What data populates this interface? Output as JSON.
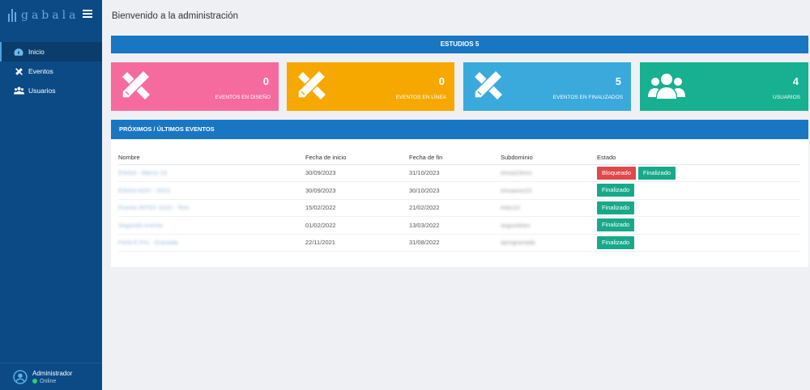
{
  "brand": {
    "name": "gabala"
  },
  "header": {
    "title": "Bienvenido a la administración"
  },
  "sidebar": {
    "items": [
      {
        "label": "Inicio",
        "icon": "dashboard-icon",
        "active": true
      },
      {
        "label": "Eventos",
        "icon": "tools-icon"
      },
      {
        "label": "Usuarios",
        "icon": "users-icon"
      }
    ],
    "user": {
      "name": "Administrador",
      "status": "Online"
    }
  },
  "banner": {
    "text": "ESTUDIOS 5"
  },
  "stats": [
    {
      "value": "0",
      "label": "EVENTOS EN DISEÑO",
      "color": "#f56b9e",
      "icon": "pencil-ruler-icon"
    },
    {
      "value": "0",
      "label": "EVENTOS EN LÍNEA",
      "color": "#f7a800",
      "icon": "pencil-ruler-icon"
    },
    {
      "value": "5",
      "label": "EVENTOS EN FINALIZADOS",
      "color": "#3aa9dc",
      "icon": "pencil-ruler-icon"
    },
    {
      "value": "4",
      "label": "USUARIOS",
      "color": "#17b091",
      "icon": "users-icon"
    }
  ],
  "events": {
    "title": "PRÓXIMOS / ÚLTIMOS EVENTOS",
    "columns": [
      "Nombre",
      "Fecha de inicio",
      "Fecha de fin",
      "Subdominio",
      "Estado"
    ],
    "rows": [
      {
        "name": "EINSA - Marzo 23",
        "start": "30/09/2023",
        "end": "31/10/2023",
        "sub": "einsa23mrz",
        "states": [
          "Bloqueado",
          "Finalizado"
        ]
      },
      {
        "name": "EINSA NOV - 2023",
        "start": "30/09/2023",
        "end": "30/10/2023",
        "sub": "einsanov23",
        "states": [
          "Finalizado"
        ]
      },
      {
        "name": "Evento INTEC 2022 - Test",
        "start": "15/02/2022",
        "end": "21/02/2022",
        "sub": "intec22",
        "states": [
          "Finalizado"
        ]
      },
      {
        "name": "Segundo evento",
        "start": "01/02/2022",
        "end": "13/03/2022",
        "sub": "segundoev",
        "states": [
          "Finalizado"
        ]
      },
      {
        "name": "Feria E.Pro - Granada",
        "start": "22/11/2021",
        "end": "31/08/2022",
        "sub": "eprogranada",
        "states": [
          "Finalizado"
        ]
      }
    ]
  },
  "colors": {
    "bloqueado": "#e0484a",
    "finalizado": "#17a98a",
    "sidebar": "#0c4a86",
    "accent": "#1976c2"
  }
}
